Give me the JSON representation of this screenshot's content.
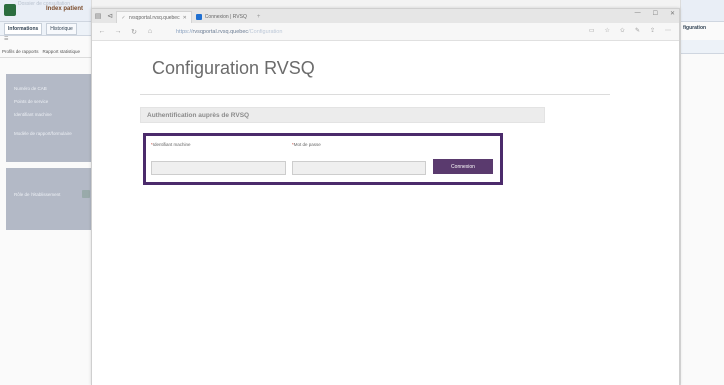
{
  "background_app": {
    "top_faint_text": "Dossier de consultation",
    "title": "Index patient",
    "tabs": [
      {
        "label": "Informations",
        "active": true
      },
      {
        "label": "Historique",
        "active": false
      }
    ],
    "mini": "☰",
    "subtabs": [
      "Profils de rapports",
      "Rapport statistique"
    ],
    "panel1_items": [
      "Numéro de CAB",
      "Points de service",
      "Identifiant machine",
      "Modèle de rapport/formulaire"
    ],
    "panel2_items": [
      "Rôle de l'établissement"
    ],
    "right_title": "figuration"
  },
  "browser": {
    "tabs": [
      {
        "title": "rvsqportal.rvsq.quebec",
        "active": true,
        "icon": "lock-icon"
      },
      {
        "title": "Connexion | RVSQ",
        "active": false,
        "icon": "ms-icon"
      }
    ],
    "new_tab": "+",
    "window_controls": [
      "—",
      "☐",
      "✕"
    ],
    "url_prefix": "https://",
    "url_host": "rvsqportal.rvsq.quebec",
    "url_path": "/Configuration",
    "accent_color": "#5a3a6e"
  },
  "page": {
    "title": "Configuration RVSQ",
    "section_label": "Authentification auprès de RVSQ",
    "form": {
      "user_label": "Identifiant machine",
      "password_label": "Mot de passe",
      "required_mark": "*",
      "user_value": "",
      "password_value": "",
      "connect_button": "Connexion"
    }
  }
}
